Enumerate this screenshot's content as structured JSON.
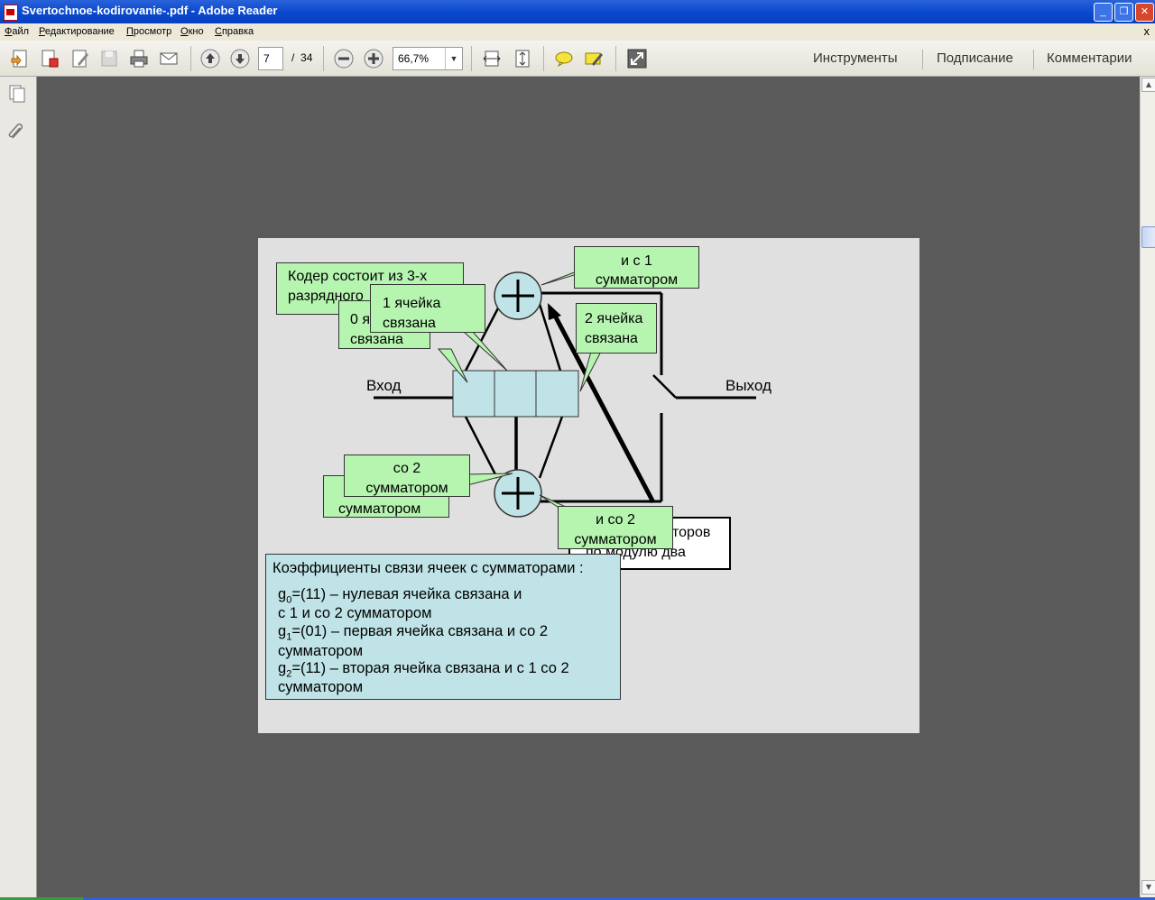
{
  "window": {
    "title": "Svertochnoe-kodirovanie-.pdf - Adobe Reader",
    "buttons": {
      "minimize": "_",
      "maximize": "❐",
      "close": "✕"
    }
  },
  "menu": {
    "items": [
      "Файл",
      "Редактирование",
      "Просмотр",
      "Окно",
      "Справка"
    ],
    "close_glyph": "x"
  },
  "toolbar": {
    "icons": [
      "create-pdf-icon",
      "combine-icon",
      "edit-icon",
      "save-icon",
      "print-icon",
      "email-icon",
      "prev-page-icon",
      "next-page-icon",
      "zoom-out-icon",
      "zoom-in-icon",
      "fit-width-icon",
      "fit-page-icon",
      "comment-icon",
      "highlight-icon",
      "fullscreen-icon"
    ],
    "page_current": "7",
    "page_separator": "/",
    "page_total": "34",
    "zoom": "66,7%",
    "right_links": [
      "Инструменты",
      "Подписание",
      "Комментарии"
    ]
  },
  "left_pane": {
    "icons": [
      "pages-icon",
      "attachments-icon"
    ]
  },
  "slide": {
    "callouts": {
      "coder": [
        "Кодер состоит из 3-х",
        "разрядного"
      ],
      "zero_cell": [
        "0 я",
        "связана"
      ],
      "first_cell": [
        "1 ячейка",
        "связана"
      ],
      "sum1": [
        "и с 1",
        "сумматором"
      ],
      "second_cell": [
        "2 ячейка",
        "связана"
      ],
      "so2_a": [
        "со 2",
        "сумматором"
      ],
      "summator_back": "сумматором",
      "i_so2": [
        "и со 2",
        "сумматором"
      ],
      "adders_white": [
        "торов",
        "по модулю два"
      ]
    },
    "input_label": "Вход",
    "output_label": "Выход",
    "coefficients": {
      "header": "Коэффициенты связи ячеек с сумматорами :",
      "lines": [
        {
          "g": "g",
          "sub": "0",
          "rest": "=(11) – нулевая ячейка связана и"
        },
        {
          "text": "с 1 и со 2 сумматором"
        },
        {
          "g": "g",
          "sub": "1",
          "rest": "=(01) – первая ячейка связана  и со 2"
        },
        {
          "text": "сумматором"
        },
        {
          "g": "g",
          "sub": "2",
          "rest": "=(11) – вторая ячейка связана и с 1 со 2"
        },
        {
          "text": "сумматором"
        }
      ]
    }
  },
  "colors": {
    "page_bg": "#5a5a5a",
    "callout_green": "#b6f5b0",
    "register_blue": "#bfe3e6"
  }
}
